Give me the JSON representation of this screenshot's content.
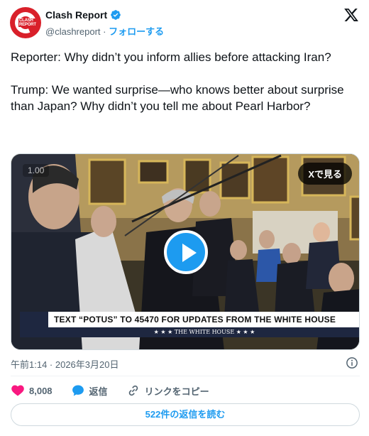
{
  "author": {
    "name": "Clash Report",
    "handle": "@clashreport",
    "separator": " · ",
    "follow_label": "フォローする",
    "logo_text_line1": "CLASH",
    "logo_text_line2": "REPORT"
  },
  "tweet": {
    "text": "Reporter: Why didn’t you inform allies before attacking Iran?\n\nTrump: We wanted surprise—who knows better about surprise than Japan? Why didn’t you tell me about Pearl Harbor?"
  },
  "media": {
    "playback_speed": "1.00",
    "view_on_x_label": "Xで見る",
    "lower_third_text": "TEXT “POTUS” TO 45470 FOR UPDATES FROM THE WHITE HOUSE",
    "lower_third_sub": "★ ★ ★  THE WHITE HOUSE  ★ ★ ★"
  },
  "timestamp": "午前1:14 · 2026年3月20日",
  "actions": {
    "likes": "8,008",
    "reply_label": "返信",
    "copy_link_label": "リンクをコピー"
  },
  "read_replies_label": "522件の返信を読む",
  "colors": {
    "accent": "#1d9bf0",
    "like": "#f91880",
    "text": "#0f1419",
    "muted": "#536471",
    "brand_red": "#d9202a"
  },
  "icons": [
    "verified-badge-icon",
    "x-logo-icon",
    "play-icon",
    "info-icon",
    "heart-icon",
    "reply-bubble-icon",
    "link-icon"
  ]
}
